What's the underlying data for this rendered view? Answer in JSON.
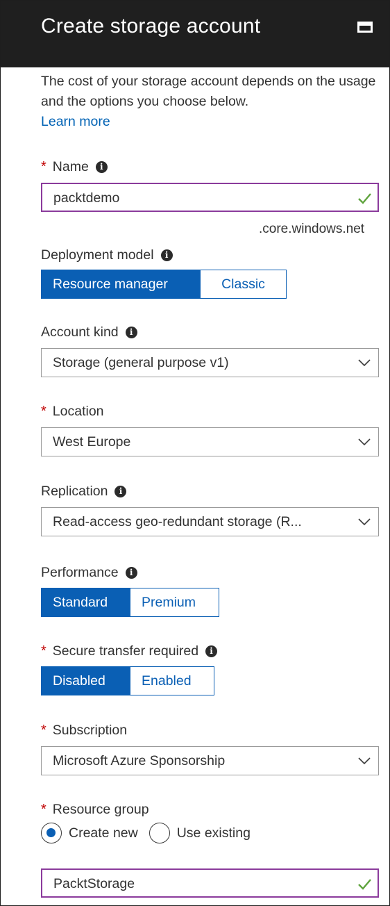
{
  "header": {
    "title": "Create storage account"
  },
  "intro": {
    "text": "The cost of your storage account depends on the usage and the options you choose below.",
    "link": "Learn more"
  },
  "name": {
    "label": "Name",
    "value": "packtdemo",
    "suffix": ".core.windows.net"
  },
  "deployment_model": {
    "label": "Deployment model",
    "options": [
      "Resource manager",
      "Classic"
    ],
    "selected": "Resource manager"
  },
  "account_kind": {
    "label": "Account kind",
    "value": "Storage (general purpose v1)"
  },
  "location": {
    "label": "Location",
    "value": "West Europe"
  },
  "replication": {
    "label": "Replication",
    "value": "Read-access geo-redundant storage (R..."
  },
  "performance": {
    "label": "Performance",
    "options": [
      "Standard",
      "Premium"
    ],
    "selected": "Standard"
  },
  "secure_transfer": {
    "label": "Secure transfer required",
    "options": [
      "Disabled",
      "Enabled"
    ],
    "selected": "Disabled"
  },
  "subscription": {
    "label": "Subscription",
    "value": "Microsoft Azure Sponsorship"
  },
  "resource_group": {
    "label": "Resource group",
    "radio_create": "Create new",
    "radio_existing": "Use existing",
    "selected": "Create new",
    "value": "PacktStorage"
  },
  "colors": {
    "header_bg": "#1f1f1f",
    "accent": "#0a5fb4",
    "required": "#c00000",
    "valid_border": "#8b3b9c",
    "check": "#5ea33c"
  },
  "icons": {
    "info": "info-icon",
    "required": "asterisk",
    "valid": "checkmark-icon",
    "dropdown": "chevron-down-icon",
    "maximize": "maximize-icon"
  }
}
